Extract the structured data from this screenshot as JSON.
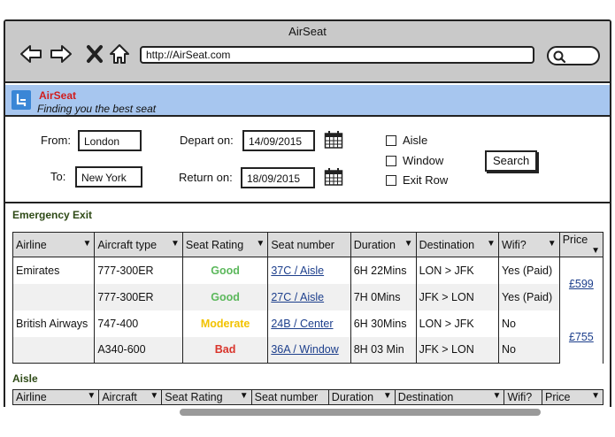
{
  "window": {
    "title": "AirSeat"
  },
  "browser": {
    "url": "http://AirSeat.com",
    "nav_icons": [
      "back-arrow-icon",
      "forward-arrow-icon",
      "close-icon",
      "home-icon"
    ],
    "search_icon": "search-icon"
  },
  "brand": {
    "name": "AirSeat",
    "tagline": "Finding you the best seat",
    "logo_icon": "seat-icon",
    "name_color": "#d11c1c",
    "bar_color": "#a7c6ef"
  },
  "search_form": {
    "from_label": "From:",
    "from_value": "London",
    "to_label": "To:",
    "to_value": "New York",
    "depart_label": "Depart on:",
    "depart_value": "14/09/2015",
    "return_label": "Return on:",
    "return_value": "18/09/2015",
    "options": [
      {
        "label": "Aisle",
        "checked": false
      },
      {
        "label": "Window",
        "checked": false
      },
      {
        "label": "Exit Row",
        "checked": false
      }
    ],
    "search_button": "Search",
    "calendar_icon": "calendar-icon"
  },
  "sections": [
    {
      "title": "Emergency Exit",
      "columns": [
        "Airline",
        "Aircraft type",
        "Seat Rating",
        "Seat number",
        "Duration",
        "Destination",
        "Wifi?",
        "Price"
      ],
      "rows": [
        {
          "airline": "Emirates",
          "aircraft": "777-300ER",
          "rating": "Good",
          "rating_color": "#5cb85c",
          "seat": "37C / Aisle",
          "duration": "6H 22Mins",
          "destination": "LON > JFK",
          "wifi": "Yes (Paid)",
          "price": "£599"
        },
        {
          "airline": "",
          "aircraft": "777-300ER",
          "rating": "Good",
          "rating_color": "#5cb85c",
          "seat": "27C / Aisle",
          "duration": "7H 0Mins",
          "destination": "JFK > LON",
          "wifi": "Yes (Paid)",
          "price": ""
        },
        {
          "airline": "British Airways",
          "aircraft": "747-400",
          "rating": "Moderate",
          "rating_color": "#f2c200",
          "seat": "24B / Center",
          "duration": "6H 30Mins",
          "destination": "LON > JFK",
          "wifi": "No",
          "price": "£755"
        },
        {
          "airline": "",
          "aircraft": "A340-600",
          "rating": "Bad",
          "rating_color": "#d9342b",
          "seat": "36A / Window",
          "duration": "8H 03 Min",
          "destination": "JFK > LON",
          "wifi": "No",
          "price": ""
        }
      ]
    },
    {
      "title": "Aisle",
      "columns": [
        "Airline",
        "Aircraft",
        "Seat Rating",
        "Seat number",
        "Duration",
        "Destination",
        "Wifi?",
        "Price"
      ]
    }
  ],
  "dropdown_arrow": "▼"
}
